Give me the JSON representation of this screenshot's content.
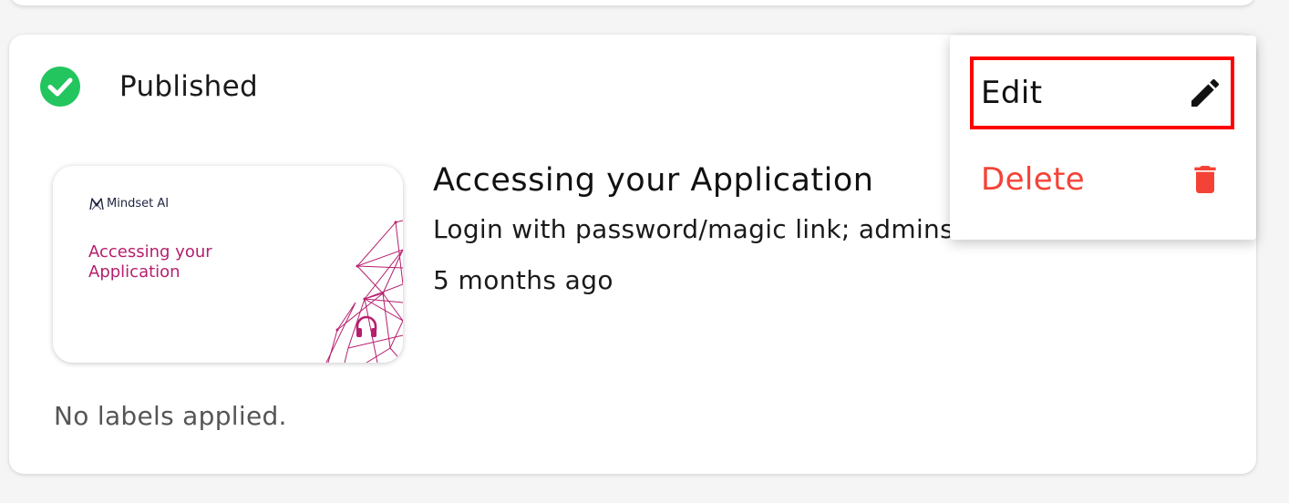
{
  "card": {
    "status": {
      "label": "Published",
      "color": "#22c55e"
    },
    "thumbnail": {
      "brand": "Mindset AI",
      "title": "Accessing your Application",
      "accent_color": "#b51f6e",
      "media_icon": "headphones-icon"
    },
    "title": "Accessing your Application",
    "description": "Login with password/magic link; admins use URL.",
    "updated": "5 months ago",
    "labels_note": "No labels applied."
  },
  "menu": {
    "items": [
      {
        "label": "Edit",
        "icon": "pencil-icon",
        "color": "#111111",
        "highlighted": true
      },
      {
        "label": "Delete",
        "icon": "trash-icon",
        "color": "#f44336"
      }
    ]
  }
}
